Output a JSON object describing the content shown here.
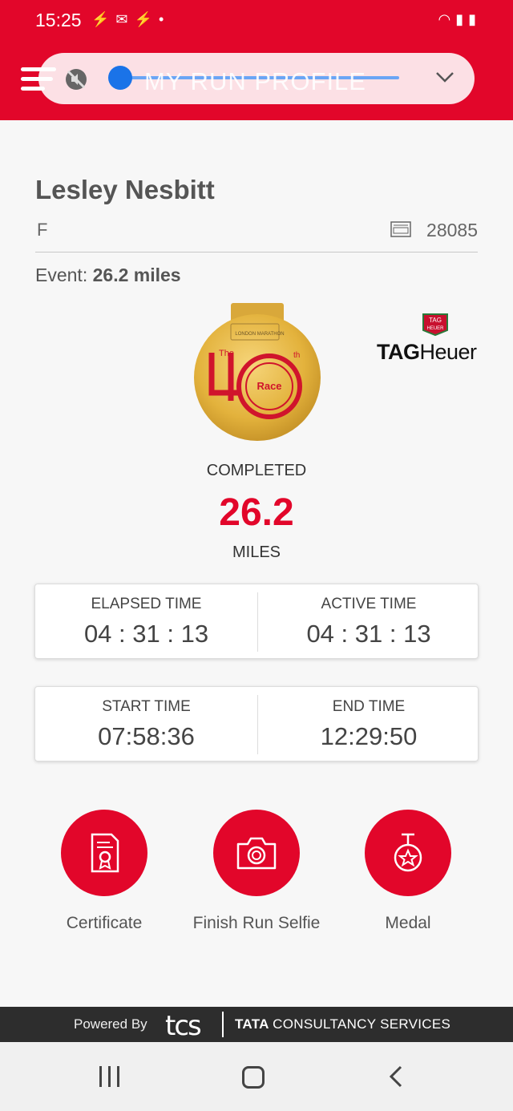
{
  "status_bar": {
    "time": "15:25",
    "left_icons": [
      "activity-icon",
      "mail-icon",
      "activity-icon",
      "dot-icon"
    ],
    "right_icons": [
      "wifi-icon",
      "signal-icon",
      "battery-icon"
    ]
  },
  "header": {
    "title": "MY RUN PROFILE",
    "accent_color": "#e2062a",
    "overlay_control": "slider",
    "slider_color": "#1a73e8"
  },
  "profile": {
    "name": "Lesley Nesbitt",
    "gender": "F",
    "bib_number": "28085",
    "event_label": "Event:",
    "event_value": "26.2 miles"
  },
  "medal": {
    "text_the": "The",
    "number": "40",
    "text_th": "th",
    "race_text": "Race",
    "event_text": "LONDON MARATHON"
  },
  "sponsor": {
    "badge_line1": "TAG",
    "badge_line2": "HEUER",
    "brand_bold": "TAG",
    "brand_regular": "Heuer"
  },
  "result": {
    "status": "COMPLETED",
    "distance": "26.2",
    "unit": "MILES"
  },
  "times": {
    "elapsed_label": "ELAPSED TIME",
    "elapsed_value": "04 : 31 : 13",
    "active_label": "ACTIVE TIME",
    "active_value": "04 : 31 : 13",
    "start_label": "START TIME",
    "start_value": "07:58:36",
    "end_label": "END TIME",
    "end_value": "12:29:50"
  },
  "actions": [
    {
      "label": "Certificate",
      "icon": "certificate-icon"
    },
    {
      "label": "Finish Run Selfie",
      "icon": "camera-icon"
    },
    {
      "label": "Medal",
      "icon": "medal-icon"
    }
  ],
  "footer": {
    "powered_by": "Powered By",
    "tcs": "tcs",
    "tata": "TATA",
    "company": "CONSULTANCY SERVICES"
  },
  "nav": {
    "items": [
      "recents",
      "home",
      "back"
    ]
  }
}
